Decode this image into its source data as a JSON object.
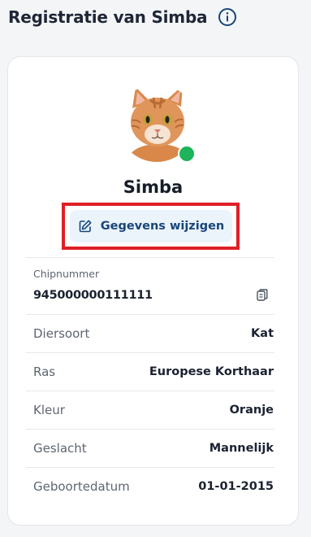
{
  "header": {
    "title": "Registratie van Simba",
    "info_icon": "info-circle-icon"
  },
  "profile": {
    "name": "Simba",
    "avatar": "cat-photo",
    "status_color": "#1db45a"
  },
  "edit_button": {
    "label": "Gegevens wijzigen",
    "icon": "pencil-edit-icon"
  },
  "chip": {
    "label": "Chipnummer",
    "value": "945000000111111",
    "copy_icon": "copy-clipboard-icon"
  },
  "fields": [
    {
      "label": "Diersoort",
      "value": "Kat"
    },
    {
      "label": "Ras",
      "value": "Europese Korthaar"
    },
    {
      "label": "Kleur",
      "value": "Oranje"
    },
    {
      "label": "Geslacht",
      "value": "Mannelijk"
    },
    {
      "label": "Geboortedatum",
      "value": "01-01-2015"
    }
  ],
  "colors": {
    "accent": "#18467a",
    "highlight": "#e01f26",
    "status": "#1db45a"
  }
}
